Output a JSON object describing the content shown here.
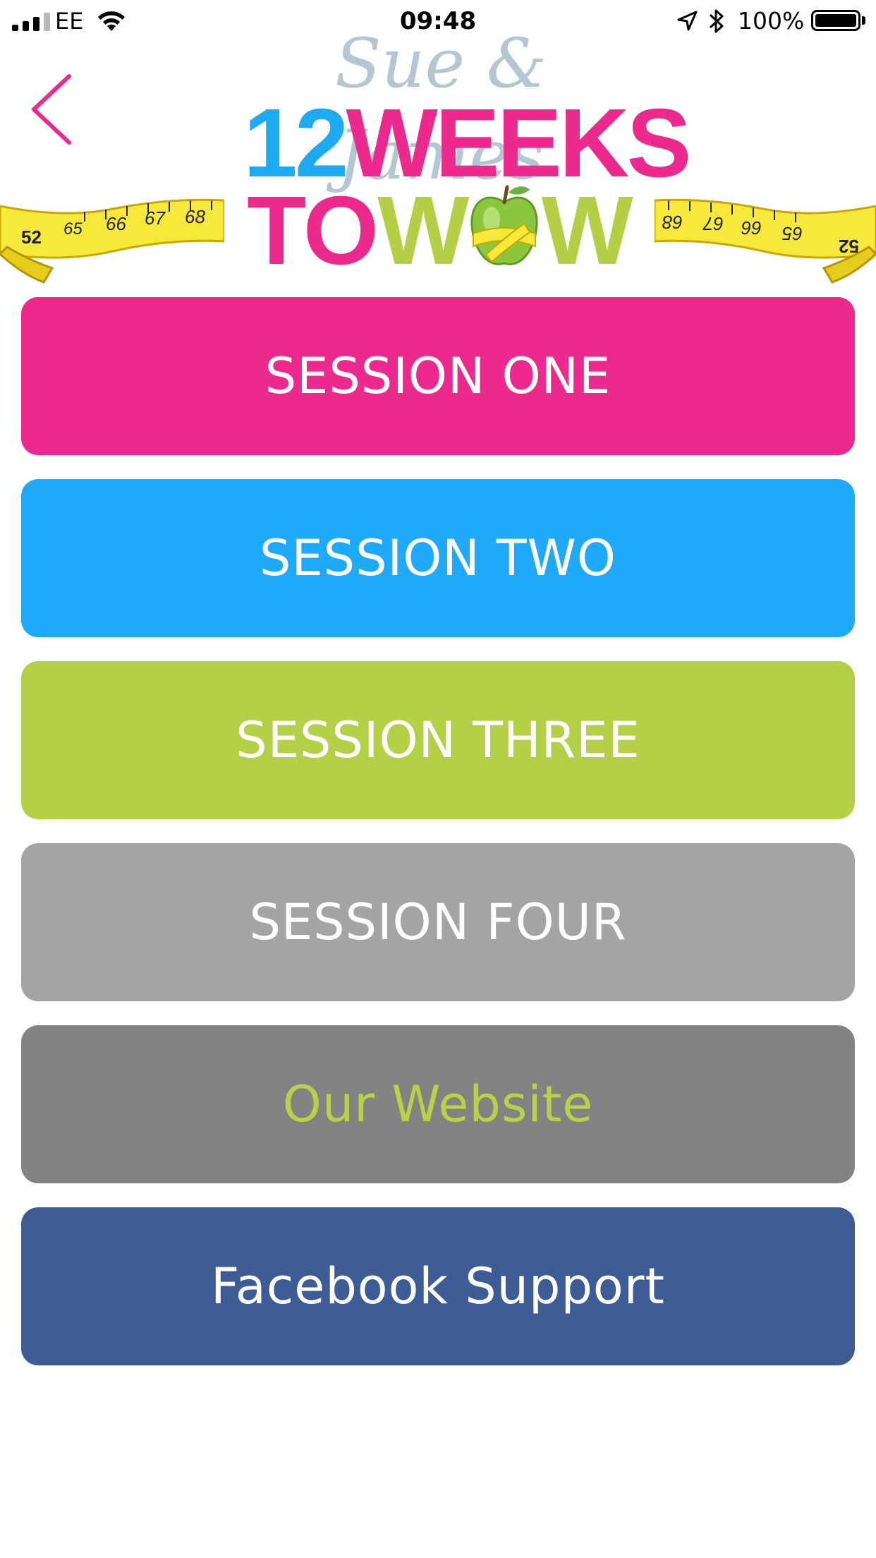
{
  "status_bar": {
    "carrier": "EE",
    "time": "09:48",
    "battery": "100%",
    "battery_level": 1.0,
    "signal_bars": 3
  },
  "header": {
    "logo": {
      "script_text": "Sue & James",
      "line1_number": "12",
      "line1_word": "WEEKS",
      "line2_word_a": "TO",
      "line2_w1": "W",
      "line2_w2": "W"
    },
    "tape_numbers_left": [
      "52",
      "65",
      "66",
      "67",
      "68"
    ],
    "tape_numbers_right": [
      "68",
      "67",
      "66",
      "65",
      "52"
    ]
  },
  "menu": {
    "items": [
      {
        "label": "SESSION ONE",
        "color": "#ec2a8e",
        "text_color": "#ffffff"
      },
      {
        "label": "SESSION TWO",
        "color": "#1eaaf9",
        "text_color": "#ffffff"
      },
      {
        "label": "SESSION THREE",
        "color": "#b4d046",
        "text_color": "#ffffff"
      },
      {
        "label": "SESSION FOUR",
        "color": "#a4a4a4",
        "text_color": "#ffffff"
      },
      {
        "label": "Our Website",
        "color": "#838383",
        "text_color": "#b8d248"
      },
      {
        "label": "Facebook Support",
        "color": "#3d5b94",
        "text_color": "#ffffff"
      }
    ]
  },
  "colors": {
    "brand_pink": "#ec2a8e",
    "brand_blue": "#1eaaf1",
    "brand_green": "#b4cf46",
    "tape_yellow": "#f6e93b"
  }
}
